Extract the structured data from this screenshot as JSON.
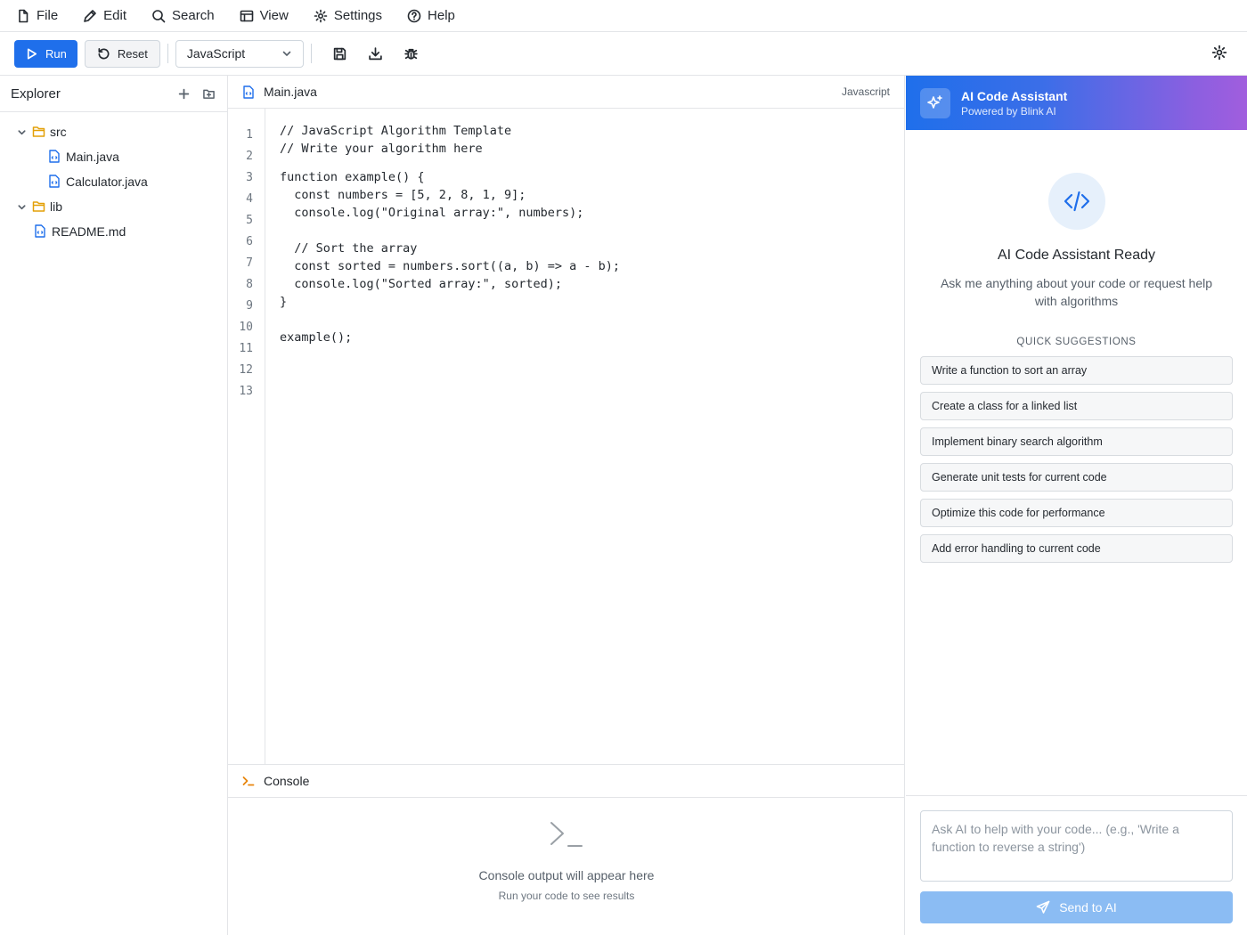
{
  "menu": {
    "file": "File",
    "edit": "Edit",
    "search": "Search",
    "view": "View",
    "settings": "Settings",
    "help": "Help"
  },
  "toolbar": {
    "run_label": "Run",
    "reset_label": "Reset",
    "language": "JavaScript"
  },
  "explorer": {
    "title": "Explorer",
    "tree": [
      {
        "name": "src",
        "type": "folder",
        "expanded": true
      },
      {
        "name": "Main.java",
        "type": "file"
      },
      {
        "name": "Calculator.java",
        "type": "file"
      },
      {
        "name": "lib",
        "type": "folder",
        "expanded": true
      },
      {
        "name": "README.md",
        "type": "file"
      }
    ]
  },
  "editor": {
    "tab_name": "Main.java",
    "language_label": "Javascript",
    "line_numbers": [
      "1",
      "2",
      "3",
      "4",
      "5",
      "6",
      "7",
      "8",
      "9",
      "10",
      "11",
      "12",
      "13"
    ],
    "lines": [
      "// JavaScript Algorithm Template",
      "// Write your algorithm here",
      "",
      "function example() {",
      "  const numbers = [5, 2, 8, 1, 9];",
      "  console.log(\"Original array:\", numbers);",
      "",
      "  // Sort the array",
      "  const sorted = numbers.sort((a, b) => a - b);",
      "  console.log(\"Sorted array:\", sorted);",
      "}",
      "",
      "example();"
    ]
  },
  "console": {
    "title": "Console",
    "empty_message": "Console output will appear here",
    "empty_sub": "Run your code to see results"
  },
  "ai": {
    "title": "AI Code Assistant",
    "subtitle": "Powered by Blink AI",
    "ready_title": "AI Code Assistant Ready",
    "description": "Ask me anything about your code or request help with algorithms",
    "suggestions_title": "QUICK SUGGESTIONS",
    "suggestions": [
      "Write a function to sort an array",
      "Create a class for a linked list",
      "Implement binary search algorithm",
      "Generate unit tests for current code",
      "Optimize this code for performance",
      "Add error handling to current code"
    ],
    "input_placeholder": "Ask AI to help with your code... (e.g., 'Write a function to reverse a string')",
    "send_label": "Send to AI"
  },
  "colors": {
    "accent": "#1f6feb",
    "folder": "#e3a008",
    "console_prompt": "#e8850c",
    "send_disabled": "#8bbcf3"
  }
}
